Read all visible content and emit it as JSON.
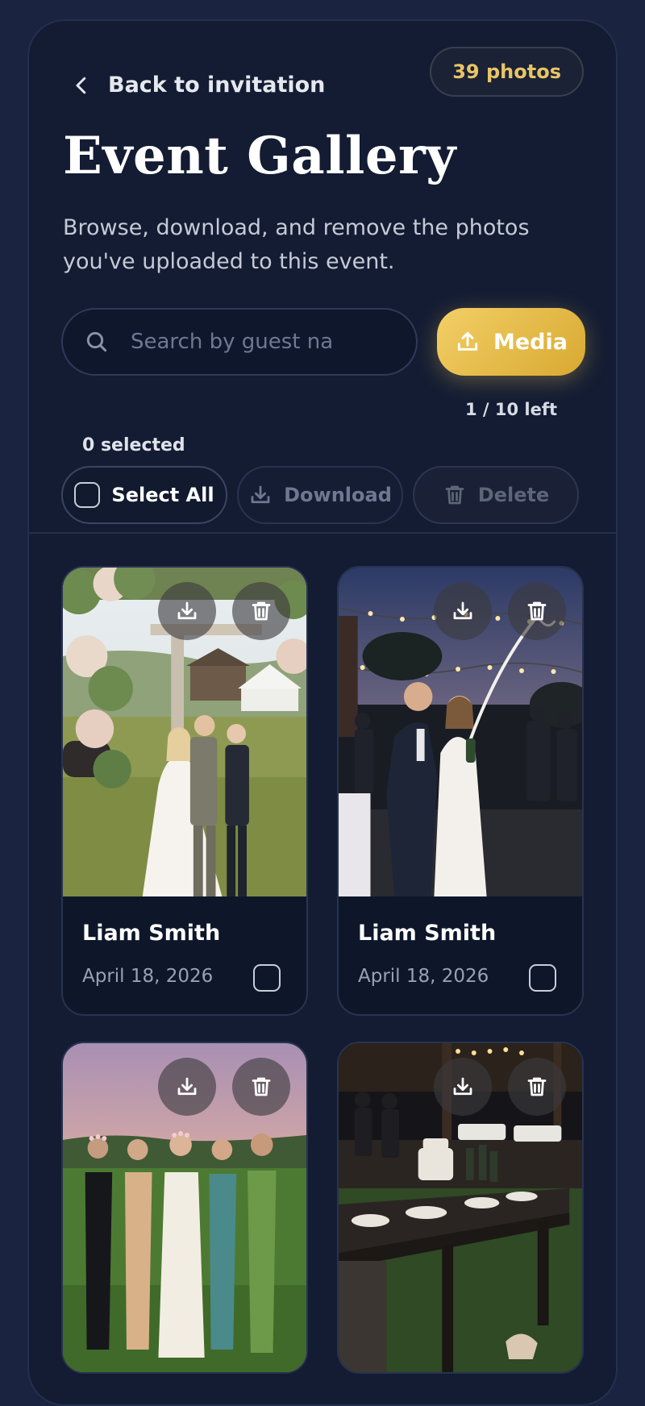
{
  "header": {
    "back_label": "Back to invitation",
    "photo_count": "39 photos",
    "title": "Event Gallery",
    "subtitle": "Browse, download, and remove the photos you've uploaded to this event."
  },
  "search": {
    "placeholder": "Search by guest na"
  },
  "upload": {
    "label": "Media",
    "remaining": "1 / 10 left"
  },
  "selection": {
    "count_label": "0 selected",
    "select_all_label": "Select All",
    "download_label": "Download",
    "delete_label": "Delete"
  },
  "photos": [
    {
      "guest": "Liam Smith",
      "date": "April 18, 2026",
      "scene": "ceremony-arch-icon"
    },
    {
      "guest": "Liam Smith",
      "date": "April 18, 2026",
      "scene": "champagne-night-icon"
    },
    {
      "guest": "",
      "date": "",
      "scene": "bridesmaids-sunset-icon"
    },
    {
      "guest": "",
      "date": "",
      "scene": "reception-table-icon"
    }
  ],
  "colors": {
    "background": "#1a2340",
    "card": "#131c33",
    "accent_gold": "#e8c565",
    "media_button": "#e6bb47"
  }
}
